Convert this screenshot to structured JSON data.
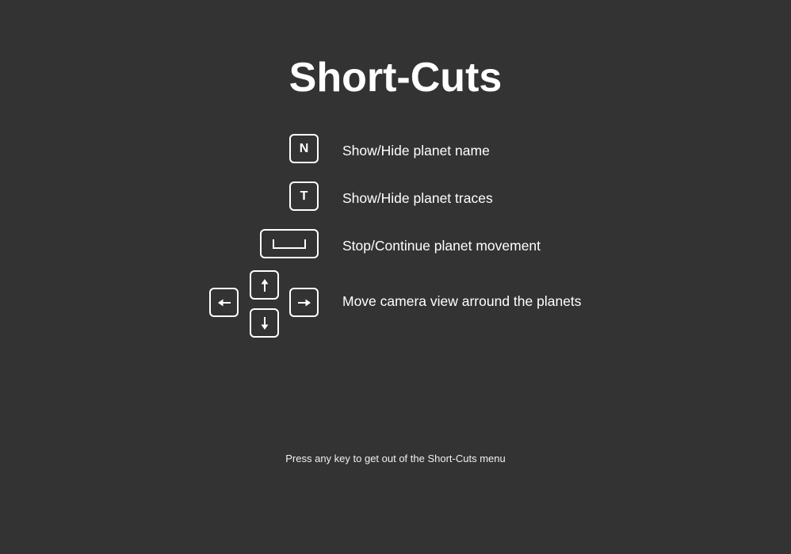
{
  "title": "Short-Cuts",
  "shortcuts": [
    {
      "key": "N",
      "description": "Show/Hide planet name"
    },
    {
      "key": "T",
      "description": "Show/Hide planet traces"
    },
    {
      "key": "space-key-icon",
      "description": "Stop/Continue planet movement"
    },
    {
      "key": "arrow-keys-icon",
      "description": "Move camera view arround the planets"
    }
  ],
  "footer": "Press any key to get out of the Short-Cuts menu",
  "colors": {
    "background": "#333333",
    "text": "#ffffff"
  }
}
